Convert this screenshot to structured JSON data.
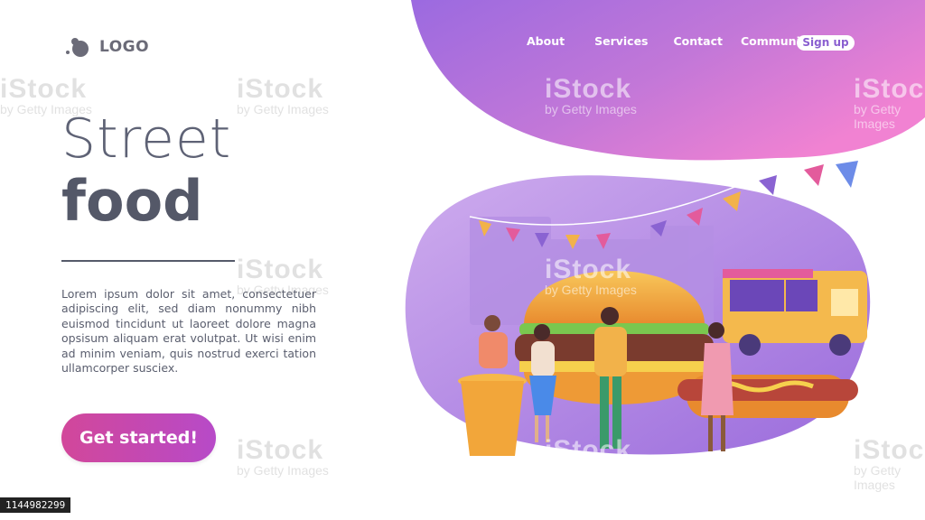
{
  "brand": {
    "logo_text": "LOGO"
  },
  "nav": {
    "items": [
      {
        "label": "About"
      },
      {
        "label": "Services"
      },
      {
        "label": "Contact"
      },
      {
        "label": "Community"
      }
    ],
    "signup_label": "Sign up"
  },
  "hero": {
    "title_line1": "Street",
    "title_line2": "food",
    "body": "Lorem ipsum dolor sit amet, consectetuer adipiscing elit, sed diam nonummy nibh euismod tincidunt ut laoreet dolore magna opsisum aliquam erat volutpat. Ut wisi enim ad minim veniam, quis nostrud exerci tation ullamcorper susciex.",
    "cta_label": "Get started!"
  },
  "watermark": {
    "brand": "iStock",
    "byline": "by Getty Images",
    "stock_id": "1144982299"
  },
  "colors": {
    "blob_top_start": "#a06be0",
    "blob_top_end": "#f07fd0",
    "cta_start": "#d2479a",
    "cta_end": "#b74ac8",
    "title": "#545868"
  }
}
